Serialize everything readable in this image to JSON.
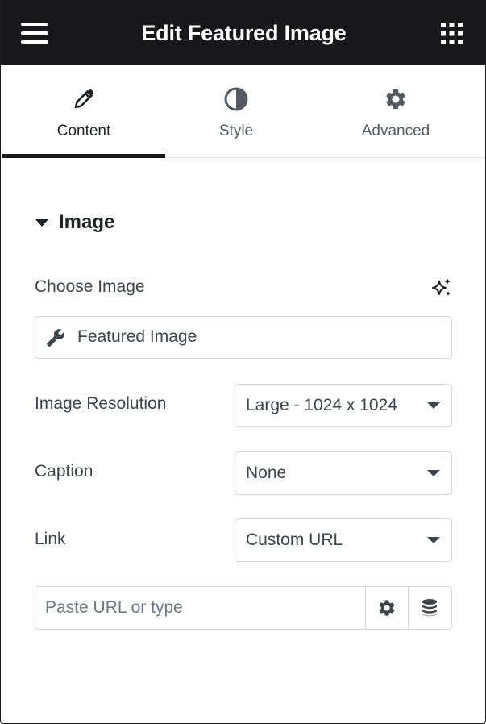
{
  "header": {
    "title": "Edit Featured Image",
    "menu_icon": "hamburger-icon",
    "apps_icon": "grid-apps-icon",
    "background_color": "#18181b"
  },
  "tabs": [
    {
      "label": "Content",
      "icon": "pencil-icon",
      "active": true
    },
    {
      "label": "Style",
      "icon": "half-circle-icon",
      "active": false
    },
    {
      "label": "Advanced",
      "icon": "gear-icon",
      "active": false
    }
  ],
  "section": {
    "title": "Image",
    "expanded": true
  },
  "fields": {
    "choose_image": {
      "label": "Choose Image",
      "ai_icon": "sparkle-ai-icon",
      "value": "Featured Image",
      "value_icon": "wrench-icon"
    },
    "image_resolution": {
      "label": "Image Resolution",
      "value": "Large - 1024 x 1024"
    },
    "caption": {
      "label": "Caption",
      "value": "None"
    },
    "link": {
      "label": "Link",
      "value": "Custom URL"
    },
    "url": {
      "placeholder": "Paste URL or type",
      "value": "",
      "settings_icon": "gear-icon",
      "dynamic_icon": "database-icon"
    }
  },
  "colors": {
    "text_primary": "#1f2124",
    "text_secondary": "#3f444b",
    "border": "#d5d8dc"
  }
}
